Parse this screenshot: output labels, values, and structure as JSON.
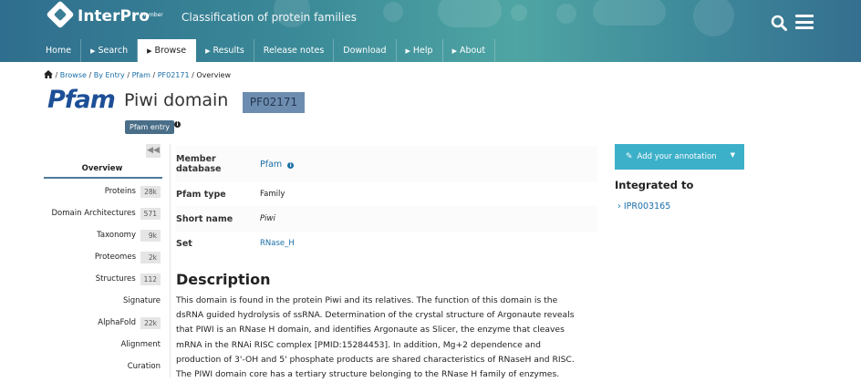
{
  "header": {
    "logo_text": "InterPro",
    "logo_member": "- Member",
    "tagline": "Classification of protein families"
  },
  "nav": {
    "items": [
      {
        "label": "Home",
        "caret": false
      },
      {
        "label": "Search",
        "caret": true
      },
      {
        "label": "Browse",
        "caret": true,
        "active": true
      },
      {
        "label": "Results",
        "caret": true
      },
      {
        "label": "Release notes",
        "caret": false
      },
      {
        "label": "Download",
        "caret": false
      },
      {
        "label": "Help",
        "caret": true
      },
      {
        "label": "About",
        "caret": true
      }
    ]
  },
  "breadcrumb": {
    "items": [
      "Browse",
      "By Entry",
      "Pfam",
      "PF02171"
    ],
    "current": "Overview",
    "separator": " / "
  },
  "entry": {
    "db_logo": "Pfam",
    "title": "Piwi domain",
    "accession": "PF02171",
    "badge": "Pfam entry"
  },
  "sidebar": {
    "collapse_glyph": "◀◀",
    "items": [
      {
        "label": "Overview",
        "count": ""
      },
      {
        "label": "Proteins",
        "count": "28k"
      },
      {
        "label": "Domain Architectures",
        "count": "571"
      },
      {
        "label": "Taxonomy",
        "count": "9k"
      },
      {
        "label": "Proteomes",
        "count": "2k"
      },
      {
        "label": "Structures",
        "count": "112"
      },
      {
        "label": "Signature",
        "count": ""
      },
      {
        "label": "AlphaFold",
        "count": "22k"
      },
      {
        "label": "Alignment",
        "count": ""
      },
      {
        "label": "Curation",
        "count": ""
      }
    ]
  },
  "info": {
    "member_db_label": "Member database",
    "member_db_value": "Pfam",
    "type_label": "Pfam type",
    "type_value": "Family",
    "short_name_label": "Short name",
    "short_name_value": "Piwi",
    "set_label": "Set",
    "set_value": "RNase_H"
  },
  "description": {
    "title": "Description",
    "lines": [
      "This domain is found in the protein Piwi and its relatives. The function of this domain is the",
      "dsRNA guided hydrolysis of ssRNA. Determination of the crystal structure of Argonaute reveals",
      "that PIWI is an RNase H domain, and identifies Argonaute as Slicer, the enzyme that cleaves",
      "mRNA in the RNAi RISC complex [PMID:15284453]. In addition, Mg+2 dependence and",
      "production of 3'-OH and 5' phosphate products are shared characteristics of RNaseH and RISC.",
      "The PIWI domain core has a tertiary structure belonging to the RNase H family of enzymes."
    ]
  },
  "right": {
    "annotation_button": "Add your annotation",
    "integrated_title": "Integrated to",
    "integrated_link": "IPR003165"
  },
  "colors": {
    "header_start": "#2f6e8e",
    "header_mid": "#4fa5a3",
    "link": "#1a6fa8",
    "accession_bg": "#6d8db0",
    "annotation_button": "#3db0c9"
  }
}
